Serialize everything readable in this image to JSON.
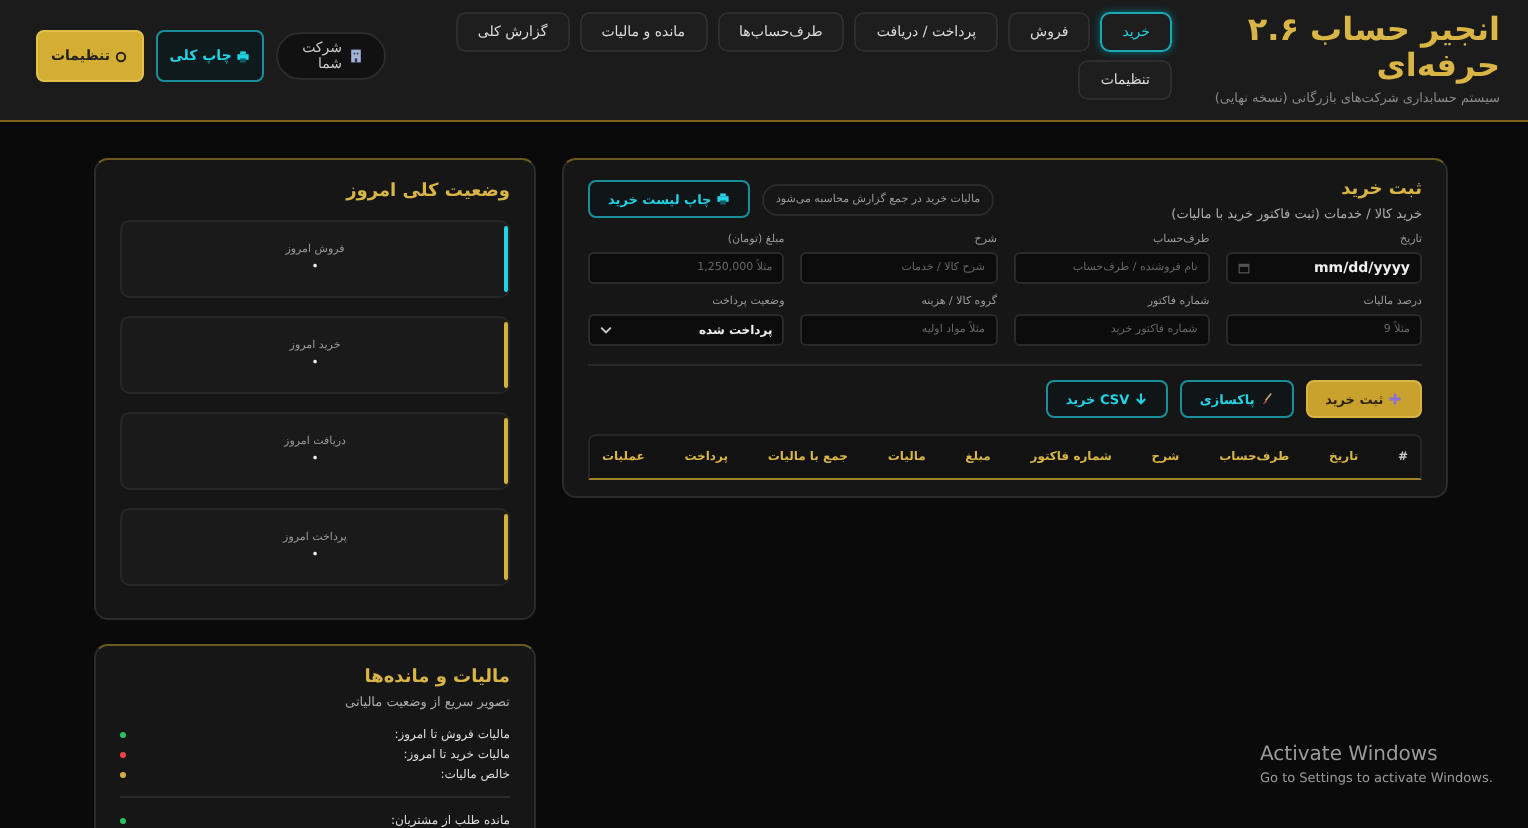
{
  "header": {
    "title": "انجیر حساب ۲.۶ حرفه‌ای",
    "subtitle": "سیستم حسابداری شرکت‌های بازرگانی (نسخه نهایی)",
    "tabs": [
      {
        "label": "خرید",
        "selected": true
      },
      {
        "label": "فروش",
        "selected": false
      },
      {
        "label": "پرداخت / دریافت",
        "selected": false
      },
      {
        "label": "طرف‌حساب‌ها",
        "selected": false
      },
      {
        "label": "مانده و مالیات",
        "selected": false
      },
      {
        "label": "گزارش کلی",
        "selected": false
      },
      {
        "label": "تنظیمات",
        "selected": false
      }
    ],
    "company": "شرکت شما",
    "print_button": "چاپ کلی",
    "settings_button": "تنظیمات"
  },
  "purchase_form": {
    "title": "ثبت خرید",
    "subtitle": "خرید کالا / خدمات (ثبت فاکتور خرید با مالیات)",
    "note": "مالیات خرید در جمع گزارش محاسبه می‌شود",
    "print_button": "چاپ لیست خرید",
    "fields": [
      {
        "kind": "date",
        "label": "تاریخ",
        "value": "mm/dd/yyyy"
      },
      {
        "kind": "text",
        "label": "طرف‌حساب",
        "placeholder": "نام فروشنده / طرف‌حساب"
      },
      {
        "kind": "text",
        "label": "شرح",
        "placeholder": "شرح کالا / خدمات"
      },
      {
        "kind": "text",
        "label": "مبلغ (تومان)",
        "placeholder": "مثلاً 1,250,000"
      },
      {
        "kind": "text",
        "label": "درصد مالیات",
        "placeholder": "مثلاً 9"
      },
      {
        "kind": "text",
        "label": "شماره فاکتور",
        "placeholder": "شماره فاکتور خرید"
      },
      {
        "kind": "text",
        "label": "گروه کالا / هزینه",
        "placeholder": "مثلاً مواد اولیه"
      },
      {
        "kind": "select",
        "label": "وضعیت پرداخت",
        "value": "پرداخت شده"
      }
    ],
    "actions": [
      {
        "kind": "add",
        "label": "ثبت خرید"
      },
      {
        "kind": "clear",
        "label": "پاکسازی"
      },
      {
        "kind": "export",
        "label": "CSV خرید"
      }
    ],
    "table": {
      "columns": [
        "#",
        "تاریخ",
        "طرف‌حساب",
        "شرح",
        "شماره فاکتور",
        "مبلغ",
        "مالیات",
        "جمع با مالیات",
        "پرداخت",
        "عملیات"
      ]
    }
  },
  "today_status": {
    "title": "وضعیت کلی امروز",
    "cards": [
      {
        "label": "فروش امروز",
        "value": "•",
        "color": "#22d3e6"
      },
      {
        "label": "خرید امروز",
        "value": "•",
        "color": "#d4b13c"
      },
      {
        "label": "دریافت امروز",
        "value": "•",
        "color": "#d4b13c"
      },
      {
        "label": "پرداخت امروز",
        "value": "•",
        "color": "#d4b13c"
      }
    ]
  },
  "taxes": {
    "title": "مالیات و مانده‌ها",
    "subtitle": "تصویر سریع از وضعیت مالیاتی",
    "rows": [
      {
        "label": "مالیات فروش تا امروز:",
        "color": "#22c55e"
      },
      {
        "label": "مالیات خرید تا امروز:",
        "color": "#ef4444"
      },
      {
        "label": "خالص مالیات:",
        "color": "#d4b13c"
      },
      {
        "label": "مانده طلب از مشتریان:",
        "color": "#22c55e"
      }
    ]
  },
  "os_notice": {
    "title": "Activate Windows",
    "text": "Go to Settings to activate Windows."
  }
}
